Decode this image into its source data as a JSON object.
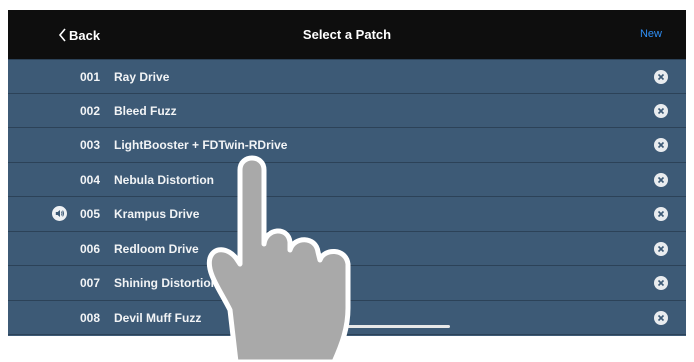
{
  "navbar": {
    "back_label": "Back",
    "title": "Select a Patch",
    "new_label": "New"
  },
  "patches": [
    {
      "number": "001",
      "name": "Ray Drive",
      "active": false
    },
    {
      "number": "002",
      "name": "Bleed Fuzz",
      "active": false
    },
    {
      "number": "003",
      "name": "LightBooster + FDTwin-RDrive",
      "active": false
    },
    {
      "number": "004",
      "name": "Nebula Distortion",
      "active": false
    },
    {
      "number": "005",
      "name": "Krampus Drive",
      "active": true
    },
    {
      "number": "006",
      "name": "Redloom Drive",
      "active": false
    },
    {
      "number": "007",
      "name": "Shining Distortion",
      "active": false
    },
    {
      "number": "008",
      "name": "Devil Muff Fuzz",
      "active": false
    }
  ],
  "icons": {
    "back": "chevron-left-icon",
    "active_patch": "speaker-icon",
    "delete": "delete-icon",
    "gesture": "tap-hand-icon"
  },
  "colors": {
    "navbar_bg": "#0e0e0e",
    "list_bg": "#3d5a76",
    "accent": "#2f8ff5",
    "text": "#f2f4f6"
  }
}
